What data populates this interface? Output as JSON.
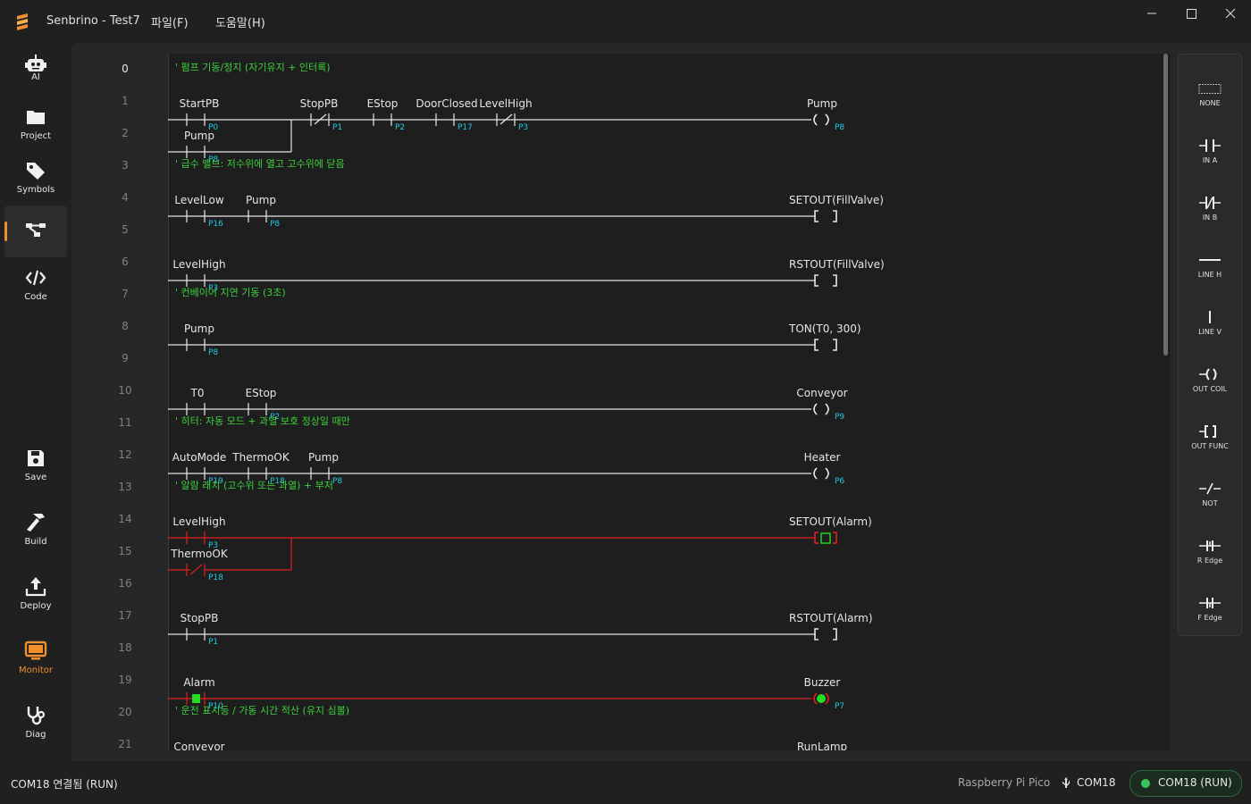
{
  "app": {
    "title": "Senbrino - Test7",
    "menus": [
      "파일(F)",
      "도움말(H)"
    ]
  },
  "sidebar": {
    "items": [
      {
        "label": "AI",
        "icon": "robot-icon"
      },
      {
        "label": "Project",
        "icon": "folder-icon"
      },
      {
        "label": "Symbols",
        "icon": "tag-icon"
      },
      {
        "label": "",
        "icon": "ladder-diagram-icon",
        "active": true
      },
      {
        "label": "Code",
        "icon": "code-icon"
      },
      {
        "label": "Save",
        "icon": "save-icon"
      },
      {
        "label": "Build",
        "icon": "hammer-icon"
      },
      {
        "label": "Deploy",
        "icon": "upload-icon"
      },
      {
        "label": "Monitor",
        "icon": "monitor-icon",
        "highlight": "#f0902c"
      },
      {
        "label": "Diag",
        "icon": "stethoscope-icon"
      }
    ]
  },
  "editor": {
    "line_numbers": [
      "0",
      "1",
      "2",
      "3",
      "4",
      "5",
      "6",
      "7",
      "8",
      "9",
      "10",
      "11",
      "12",
      "13",
      "14",
      "15",
      "16",
      "17",
      "18",
      "19",
      "20",
      "21"
    ],
    "comments": [
      "' 펌프 기동/정지 (자기유지 + 인터록)",
      "' 급수 밸브: 저수위에 열고 고수위에 닫음",
      "' 컨베이어 지연 기동 (3초)",
      "' 히터: 자동 모드 + 과열 보호 정상일 때만",
      "' 알람 래치 (고수위 또는 과열) + 부저",
      "' 운전 표시등 / 가동 시간 적산 (유지 심볼)"
    ],
    "contacts": [
      {
        "name": "StartPB",
        "addr": "P0",
        "type": "no"
      },
      {
        "name": "StopPB",
        "addr": "P1",
        "type": "nc"
      },
      {
        "name": "EStop",
        "addr": "P2",
        "type": "no"
      },
      {
        "name": "DoorClosed",
        "addr": "P17",
        "type": "no"
      },
      {
        "name": "LevelHigh",
        "addr": "P3",
        "type": "nc"
      },
      {
        "name": "Pump",
        "addr": "P8",
        "type": "no"
      },
      {
        "name": "LevelLow",
        "addr": "P16",
        "type": "no"
      },
      {
        "name": "Pump",
        "addr": "P8",
        "type": "no"
      },
      {
        "name": "LevelHigh",
        "addr": "P3",
        "type": "no"
      },
      {
        "name": "Pump",
        "addr": "P8",
        "type": "no"
      },
      {
        "name": "T0",
        "addr": "",
        "type": "no"
      },
      {
        "name": "EStop",
        "addr": "P2",
        "type": "no"
      },
      {
        "name": "AutoMode",
        "addr": "P19",
        "type": "no"
      },
      {
        "name": "ThermoOK",
        "addr": "P18",
        "type": "no"
      },
      {
        "name": "Pump",
        "addr": "P8",
        "type": "no"
      },
      {
        "name": "LevelHigh",
        "addr": "P3",
        "type": "no"
      },
      {
        "name": "ThermoOK",
        "addr": "P18",
        "type": "nc"
      },
      {
        "name": "StopPB",
        "addr": "P1",
        "type": "no"
      },
      {
        "name": "Alarm",
        "addr": "P10",
        "type": "no"
      },
      {
        "name": "Conveyor",
        "addr": "",
        "type": "no"
      }
    ],
    "outputs": [
      {
        "name": "Pump",
        "addr": "P8",
        "type": "coil"
      },
      {
        "name": "SETOUT(FillValve)",
        "addr": "",
        "type": "func"
      },
      {
        "name": "RSTOUT(FillValve)",
        "addr": "",
        "type": "func"
      },
      {
        "name": "TON(T0, 300)",
        "addr": "",
        "type": "func"
      },
      {
        "name": "Conveyor",
        "addr": "P9",
        "type": "coil"
      },
      {
        "name": "Heater",
        "addr": "P6",
        "type": "coil"
      },
      {
        "name": "SETOUT(Alarm)",
        "addr": "",
        "type": "func"
      },
      {
        "name": "RSTOUT(Alarm)",
        "addr": "",
        "type": "func"
      },
      {
        "name": "Buzzer",
        "addr": "P7",
        "type": "coil"
      },
      {
        "name": "RunLamp",
        "addr": "",
        "type": "coil"
      }
    ]
  },
  "palette": {
    "items": [
      {
        "label": "NONE",
        "icon": "none-icon"
      },
      {
        "label": "IN A",
        "icon": "contact-no-icon"
      },
      {
        "label": "IN B",
        "icon": "contact-nc-icon"
      },
      {
        "label": "LINE H",
        "icon": "line-h-icon"
      },
      {
        "label": "LINE V",
        "icon": "line-v-icon"
      },
      {
        "label": "OUT COIL",
        "icon": "coil-icon"
      },
      {
        "label": "OUT FUNC",
        "icon": "func-icon"
      },
      {
        "label": "NOT",
        "icon": "not-icon"
      },
      {
        "label": "R Edge",
        "icon": "rising-edge-icon"
      },
      {
        "label": "F Edge",
        "icon": "falling-edge-icon"
      }
    ]
  },
  "status": {
    "left": "COM18 연결됨 (RUN)",
    "board": "Raspberry Pi Pico",
    "port": "COM18",
    "connection": "COM18 (RUN)"
  },
  "colors": {
    "accent": "#f0902c",
    "wire": "#e6e6e6",
    "wire_active": "#e02020",
    "address": "#1fc8e0",
    "comment": "#3cd03c",
    "on_state": "#22dd22"
  }
}
